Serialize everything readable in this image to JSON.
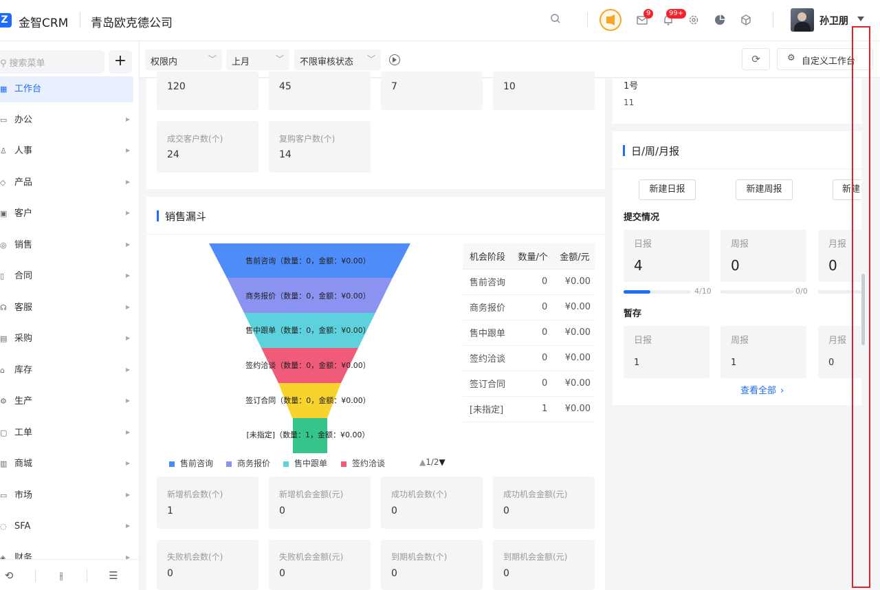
{
  "header": {
    "logo_glyph": "Z",
    "app_name": "金智CRM",
    "company": "青岛欧克德公司",
    "mail_badge": "9",
    "bell_badge": "99+",
    "user_name": "孙卫朋"
  },
  "sidebar": {
    "search_placeholder": "搜索菜单",
    "add_label": "+",
    "items": [
      {
        "label": "工作台",
        "icon": "dashboard-icon",
        "active": true
      },
      {
        "label": "办公",
        "icon": "office-icon"
      },
      {
        "label": "人事",
        "icon": "hr-icon"
      },
      {
        "label": "产品",
        "icon": "product-icon"
      },
      {
        "label": "客户",
        "icon": "customer-icon"
      },
      {
        "label": "销售",
        "icon": "sales-icon"
      },
      {
        "label": "合同",
        "icon": "contract-icon"
      },
      {
        "label": "客服",
        "icon": "service-icon"
      },
      {
        "label": "采购",
        "icon": "purchase-icon"
      },
      {
        "label": "库存",
        "icon": "inventory-icon"
      },
      {
        "label": "生产",
        "icon": "production-icon"
      },
      {
        "label": "工单",
        "icon": "workorder-icon"
      },
      {
        "label": "商城",
        "icon": "mall-icon"
      },
      {
        "label": "市场",
        "icon": "market-icon"
      },
      {
        "label": "SFA",
        "icon": "sfa-icon"
      },
      {
        "label": "财务",
        "icon": "finance-icon"
      }
    ]
  },
  "filters": {
    "scope": "权限内",
    "period": "上月",
    "review_status": "不限审核状态",
    "customize_label": "自定义工作台"
  },
  "customer_stats": {
    "top_values": [
      "120",
      "45",
      "7",
      "10"
    ],
    "cards": [
      {
        "label": "成交客户数(个)",
        "value": "24"
      },
      {
        "label": "复购客户数(个)",
        "value": "14"
      }
    ]
  },
  "funnel": {
    "title": "销售漏斗",
    "stages": [
      {
        "label": "售前咨询（数量：0，金额：¥0.00）",
        "color": "#4e8cf9"
      },
      {
        "label": "商务报价（数量：0，金额：¥0.00）",
        "color": "#8b93f0"
      },
      {
        "label": "售中跟单（数量：0，金额：¥0.00）",
        "color": "#5dd2dd"
      },
      {
        "label": "签约洽谈（数量：0，金额：¥0.00）",
        "color": "#ef5b79"
      },
      {
        "label": "签订合同（数量：0，金额：¥0.00）",
        "color": "#f8d32e"
      },
      {
        "label": "[未指定]（数量：1，金额：¥0.00）",
        "color": "#35c58a"
      }
    ],
    "legend": [
      "售前咨询",
      "商务报价",
      "售中跟单",
      "签约洽谈"
    ],
    "legend_page": "1/2",
    "table": {
      "headers": [
        "机会阶段",
        "数量/个",
        "金额/元"
      ],
      "rows": [
        [
          "售前咨询",
          "0",
          "¥0.00"
        ],
        [
          "商务报价",
          "0",
          "¥0.00"
        ],
        [
          "售中跟单",
          "0",
          "¥0.00"
        ],
        [
          "签约洽谈",
          "0",
          "¥0.00"
        ],
        [
          "签订合同",
          "0",
          "¥0.00"
        ],
        [
          "[未指定]",
          "1",
          "¥0.00"
        ]
      ]
    }
  },
  "opportunity_stats": [
    {
      "label": "新增机会数(个)",
      "value": "1"
    },
    {
      "label": "新增机会金额(元)",
      "value": "0"
    },
    {
      "label": "成功机会数(个)",
      "value": "0"
    },
    {
      "label": "成功机会金额(元)",
      "value": "0"
    },
    {
      "label": "失败机会数(个)",
      "value": "0"
    },
    {
      "label": "失败机会金额(元)",
      "value": "0"
    },
    {
      "label": "到期机会数(个)",
      "value": "0"
    },
    {
      "label": "到期机会金额(元)",
      "value": "0"
    }
  ],
  "calendar": {
    "day": "1号",
    "count": "11"
  },
  "reports": {
    "title": "日/周/月报",
    "new_daily": "新建日报",
    "new_weekly": "新建周报",
    "new_monthly": "新建",
    "submitted_title": "提交情况",
    "submitted": [
      {
        "label": "日报",
        "value": "4",
        "progress_text": "4/10",
        "progress": 0.4
      },
      {
        "label": "周报",
        "value": "0",
        "progress_text": "0/0",
        "progress": 0
      },
      {
        "label": "月报",
        "value": "0"
      }
    ],
    "draft_title": "暂存",
    "drafts": [
      {
        "label": "日报",
        "value": "1"
      },
      {
        "label": "周报",
        "value": "1"
      },
      {
        "label": "月报",
        "value": "0"
      }
    ],
    "view_all": "查看全部"
  }
}
